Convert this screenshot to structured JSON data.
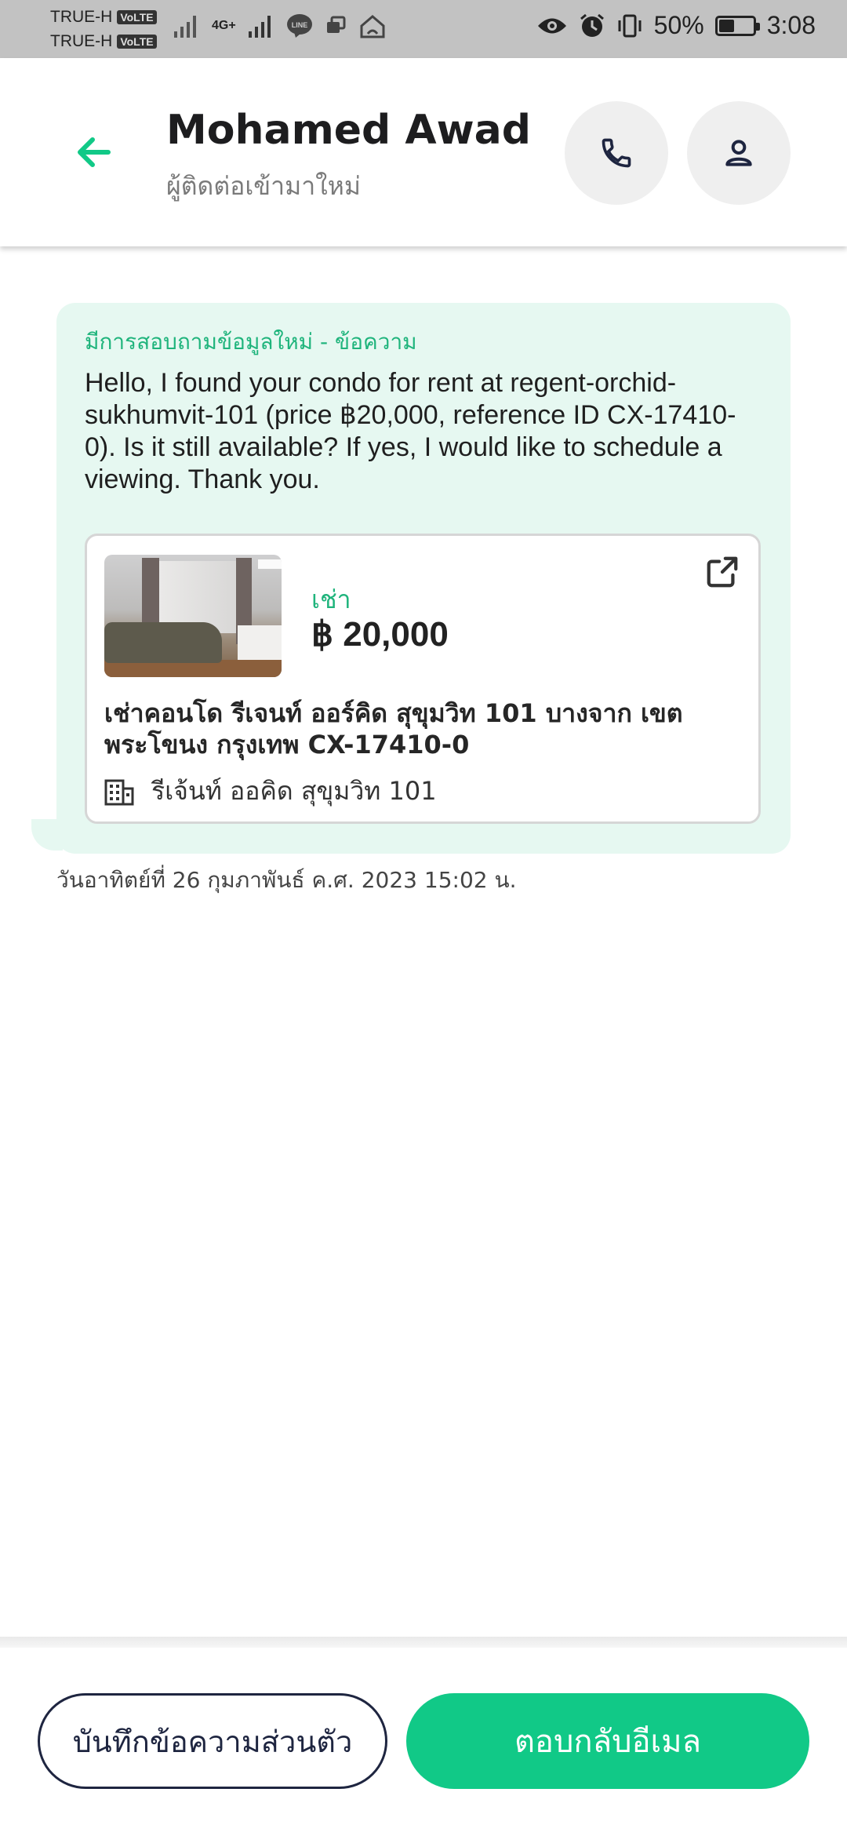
{
  "status_bar": {
    "carrier_1": "TRUE-H",
    "carrier_2": "TRUE-H",
    "volte": "VoLTE",
    "network": "4G+",
    "battery_percent": "50%",
    "battery_level": 0.5,
    "time": "3:08"
  },
  "header": {
    "contact_name": "Mohamed Awad",
    "contact_subtitle": "ผู้ติดต่อเข้ามาใหม่",
    "icons": {
      "back": "back-arrow-icon",
      "call": "phone-icon",
      "profile": "person-icon"
    }
  },
  "message": {
    "tag": "มีการสอบถามข้อมูลใหม่ - ข้อความ",
    "body": "Hello, I found your condo for rent at regent-orchid-sukhumvit-101 (price ฿20,000, reference ID CX-17410-0). Is it still available? If yes, I would like to schedule a viewing. Thank you.",
    "timestamp": "วันอาทิตย์ที่ 26 กุมภาพันธ์ ค.ศ. 2023 15:02 น."
  },
  "listing": {
    "type": "เช่า",
    "price": "฿ 20,000",
    "title": "เช่าคอนโด  รีเจนท์ ออร์คิด สุขุมวิท 101 บางจาก เขตพระโขนง กรุงเทพ CX-17410-0",
    "location": "รีเจ้นท์ ออคิด สุขุมวิท 101",
    "icons": {
      "open": "open-external-icon",
      "building": "building-icon"
    }
  },
  "actions": {
    "note_label": "บันทึกข้อความส่วนตัว",
    "reply_label": "ตอบกลับอีเมล"
  },
  "colors": {
    "accent": "#11c987",
    "bubble_bg": "#e6f8f1",
    "dark": "#1e2540"
  }
}
